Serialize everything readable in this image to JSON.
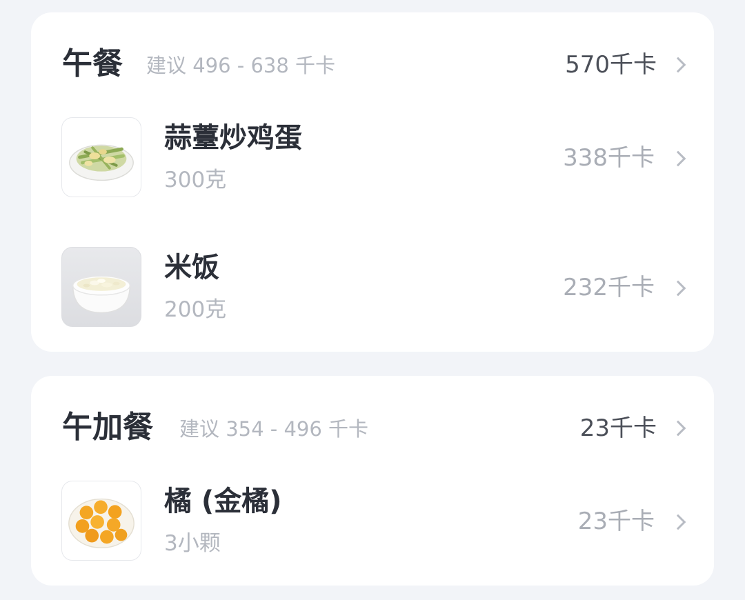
{
  "lunch": {
    "title": "午餐",
    "suggestion": "建议 496 - 638 千卡",
    "total": "570千卡",
    "items": [
      {
        "name": "蒜薹炒鸡蛋",
        "amount": "300克",
        "kcal": "338千卡",
        "icon": "stir-fried-garlic-sprout-egg-icon"
      },
      {
        "name": "米饭",
        "amount": "200克",
        "kcal": "232千卡",
        "icon": "rice-bowl-icon"
      }
    ]
  },
  "snack": {
    "title": "午加餐",
    "suggestion": "建议 354 - 496 千卡",
    "total": "23千卡",
    "items": [
      {
        "name": "橘 (金橘)",
        "amount": "3小颗",
        "kcal": "23千卡",
        "icon": "kumquat-plate-icon"
      }
    ]
  },
  "colors": {
    "background": "#f2f4f8",
    "card": "#ffffff",
    "title_text": "#2b2f38",
    "muted_text": "#b3b7bf",
    "chevron": "#b8bcc4"
  }
}
